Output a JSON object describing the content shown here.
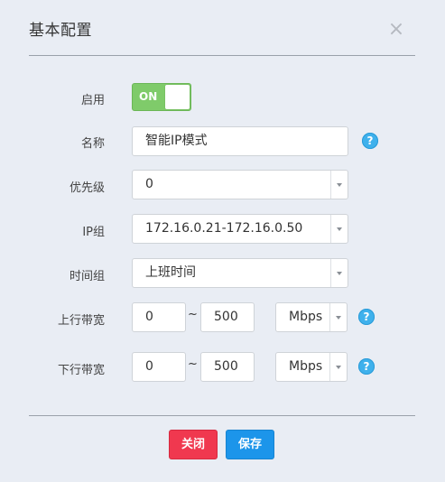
{
  "dialog": {
    "title": "基本配置",
    "close_glyph": "×"
  },
  "fields": {
    "enable": {
      "label": "启用",
      "state": "ON"
    },
    "name": {
      "label": "名称",
      "value": "智能IP模式",
      "help": "?"
    },
    "priority": {
      "label": "优先级",
      "value": "0"
    },
    "ip_group": {
      "label": "IP组",
      "value": "172.16.0.21-172.16.0.50"
    },
    "time_group": {
      "label": "时间组",
      "value": "上班时间"
    },
    "upload_bandwidth": {
      "label": "上行带宽",
      "min": "0",
      "separator": "~",
      "max": "500",
      "unit": "Mbps",
      "help": "?"
    },
    "download_bandwidth": {
      "label": "下行带宽",
      "min": "0",
      "separator": "~",
      "max": "500",
      "unit": "Mbps",
      "help": "?"
    }
  },
  "buttons": {
    "close": "关闭",
    "save": "保存"
  },
  "colors": {
    "toggle_on": "#7fcb6a",
    "help_icon": "#3fb1ec",
    "close_button": "#f0384f",
    "save_button": "#1c95ea"
  },
  "icons": {
    "dropdown": "caret-down-icon",
    "help": "question-circle-icon",
    "close": "close-icon"
  }
}
